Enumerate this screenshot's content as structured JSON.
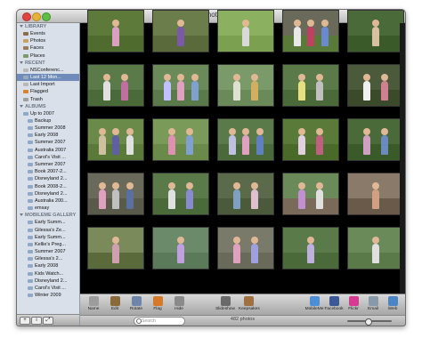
{
  "window": {
    "title": "iPhoto"
  },
  "sidebar": {
    "sections": [
      {
        "header": "LIBRARY",
        "items": [
          {
            "label": "Events",
            "color": "#8a6d4a",
            "sub": false
          },
          {
            "label": "Photos",
            "color": "#c9a063",
            "sub": false
          },
          {
            "label": "Faces",
            "color": "#9a7b5c",
            "sub": false
          },
          {
            "label": "Places",
            "color": "#7a9a6a",
            "sub": false
          }
        ]
      },
      {
        "header": "RECENT",
        "items": [
          {
            "label": "NSConferenc...",
            "color": "#b8b8b8",
            "sub": false
          },
          {
            "label": "Last 12 Mon...",
            "color": "#9aa8c0",
            "sub": false,
            "selected": true
          },
          {
            "label": "Last Import",
            "color": "#b8b8b8",
            "sub": false
          },
          {
            "label": "Flagged",
            "color": "#d9822b",
            "sub": false
          },
          {
            "label": "Trash",
            "color": "#a0a0a0",
            "sub": false
          }
        ]
      },
      {
        "header": "ALBUMS",
        "items": [
          {
            "label": "Up to 2007",
            "color": "#8fa9c8",
            "sub": false
          },
          {
            "label": "Backup",
            "color": "#8fa9c8",
            "sub": true
          },
          {
            "label": "Summer 2008",
            "color": "#8fa9c8",
            "sub": true
          },
          {
            "label": "Early 2008",
            "color": "#8fa9c8",
            "sub": true
          },
          {
            "label": "Summer 2007",
            "color": "#8fa9c8",
            "sub": true
          },
          {
            "label": "Australia 2007",
            "color": "#8fa9c8",
            "sub": true
          },
          {
            "label": "Carol's Visit ...",
            "color": "#8fa9c8",
            "sub": true
          },
          {
            "label": "Summer 2007",
            "color": "#8fa9c8",
            "sub": true
          },
          {
            "label": "Book 2007-2...",
            "color": "#8fa9c8",
            "sub": true
          },
          {
            "label": "Disneyland 2...",
            "color": "#8fa9c8",
            "sub": true
          },
          {
            "label": "Book 2008-2...",
            "color": "#8fa9c8",
            "sub": true
          },
          {
            "label": "Disneyland 2...",
            "color": "#8fa9c8",
            "sub": true
          },
          {
            "label": "Australia 200...",
            "color": "#8fa9c8",
            "sub": true
          },
          {
            "label": "emsay",
            "color": "#8fa9c8",
            "sub": true
          }
        ]
      },
      {
        "header": "MOBILEME GALLERY",
        "items": [
          {
            "label": "Early Summ...",
            "color": "#8fa9c8",
            "sub": true
          },
          {
            "label": "Gilessa's Ze...",
            "color": "#8fa9c8",
            "sub": true
          },
          {
            "label": "Early Summ...",
            "color": "#8fa9c8",
            "sub": true
          },
          {
            "label": "Kellie's Preg...",
            "color": "#8fa9c8",
            "sub": true
          },
          {
            "label": "Summer 2007",
            "color": "#8fa9c8",
            "sub": true
          },
          {
            "label": "Gilessa's 2...",
            "color": "#8fa9c8",
            "sub": true
          },
          {
            "label": "Early 2008",
            "color": "#8fa9c8",
            "sub": true
          },
          {
            "label": "Kids Watch...",
            "color": "#8fa9c8",
            "sub": true
          },
          {
            "label": "Disneyland 2...",
            "color": "#8fa9c8",
            "sub": true
          },
          {
            "label": "Carol's Visit ...",
            "color": "#8fa9c8",
            "sub": true
          },
          {
            "label": "Winter 2009",
            "color": "#8fa9c8",
            "sub": true
          }
        ]
      }
    ],
    "bottom_buttons": [
      "+",
      "i",
      "⤢"
    ]
  },
  "toolbar": {
    "left": [
      {
        "label": "Name",
        "color": "#9c9c9c"
      },
      {
        "label": "Edit",
        "color": "#8a6a3a"
      },
      {
        "label": "Rotate",
        "color": "#6f86a8"
      },
      {
        "label": "Flag",
        "color": "#d67a2a"
      },
      {
        "label": "Hide",
        "color": "#8a8a8a"
      }
    ],
    "middle": [
      {
        "label": "Slideshow",
        "color": "#6a6a6a"
      },
      {
        "label": "Keepsakes",
        "color": "#a07040"
      }
    ],
    "right": [
      {
        "label": "MobileMe",
        "color": "#4d8fd6"
      },
      {
        "label": "Facebook",
        "color": "#3b5998"
      },
      {
        "label": "Flickr",
        "color": "#d63b8f"
      },
      {
        "label": "Email",
        "color": "#8899aa"
      },
      {
        "label": "iWeb",
        "color": "#4a86c6"
      }
    ]
  },
  "status": {
    "search_placeholder": "Search",
    "photo_count": "482 photos",
    "zoom_level": 0.45
  },
  "grid": {
    "columns": 5,
    "rows": 6,
    "photos": [
      {
        "sky": "#5d7a3a",
        "grass": "#4f6b2e",
        "figs": [
          "#d9a0c0"
        ]
      },
      {
        "sky": "#6a7d4a",
        "grass": "#5a6a3a",
        "figs": [
          "#7a5aa8"
        ]
      },
      {
        "sky": "#8ab060",
        "grass": "#7aa050",
        "figs": [
          "#d9d9d9"
        ]
      },
      {
        "sky": "#6a6a5a",
        "grass": "#5a7a3a",
        "figs": [
          "#e8e8e8",
          "#c04060",
          "#6a8ad0"
        ]
      },
      {
        "sky": "#4a6a3a",
        "grass": "#3a5a2a",
        "figs": [
          "#d9c0a0"
        ]
      },
      {
        "sky": "#5a7a4a",
        "grass": "#4a6a3a",
        "figs": [
          "#e0e0e0",
          "#c070a0"
        ]
      },
      {
        "sky": "#6a8a5a",
        "grass": "#5a7a4a",
        "figs": [
          "#c0c0ff",
          "#e0a0c0",
          "#80a0d0"
        ]
      },
      {
        "sky": "#7a9a6a",
        "grass": "#6a8a5a",
        "figs": [
          "#e0e0d0",
          "#d0b060"
        ]
      },
      {
        "sky": "#5a7a4a",
        "grass": "#4a6a3a",
        "figs": [
          "#e8e080",
          "#c0c0c0"
        ]
      },
      {
        "sky": "#4a5a3a",
        "grass": "#3a4a2a",
        "figs": [
          "#f0f0f0",
          "#d08090"
        ]
      },
      {
        "sky": "#6a8a4a",
        "grass": "#5a7a3a",
        "figs": [
          "#d0c0a0",
          "#6060a0",
          "#e0e0e0"
        ]
      },
      {
        "sky": "#7a9a5a",
        "grass": "#6a8a4a",
        "figs": [
          "#e090b0",
          "#80a0d0"
        ]
      },
      {
        "sky": "#5a7a4a",
        "grass": "#4a6a3a",
        "figs": [
          "#c0c0e0",
          "#e0a0c0",
          "#6080c0"
        ]
      },
      {
        "sky": "#5a7a3a",
        "grass": "#4a6a2a",
        "figs": [
          "#e0d0e0",
          "#c06080"
        ]
      },
      {
        "sky": "#4a6a3a",
        "grass": "#3a5a2a",
        "figs": [
          "#d0a0c0",
          "#6a8ac0"
        ]
      },
      {
        "sky": "#6a6a5a",
        "grass": "#5a5a4a",
        "figs": [
          "#e0a0c0",
          "#c0c0c0",
          "#5a70a0"
        ]
      },
      {
        "sky": "#5a7a4a",
        "grass": "#4a6a3a",
        "figs": [
          "#e0e0e0",
          "#8a8ad0"
        ]
      },
      {
        "sky": "#5a6a4a",
        "grass": "#4a5a3a",
        "figs": [
          "#80a0c0",
          "#e0c0d0"
        ]
      },
      {
        "sky": "#6a8a5a",
        "grass": "#7a6a5a",
        "figs": [
          "#c090d0",
          "#e0e0e0"
        ]
      },
      {
        "sky": "#8a7a6a",
        "grass": "#6a5a4a",
        "figs": [
          "#d0a080"
        ]
      },
      {
        "sky": "#7a8a5a",
        "grass": "#5a6a3a",
        "figs": [
          "#d0a0b0"
        ]
      },
      {
        "sky": "#6a8a6a",
        "grass": "#5a7a5a",
        "figs": [
          "#c0a0e0"
        ]
      },
      {
        "sky": "#7a7a6a",
        "grass": "#6a6a5a",
        "figs": [
          "#e0a0c0",
          "#a0a0e0"
        ]
      },
      {
        "sky": "#5a7a4a",
        "grass": "#4a6a3a",
        "figs": [
          "#c0b0e0"
        ]
      },
      {
        "sky": "#6a8a5a",
        "grass": "#5a7a4a",
        "figs": [
          "#e0e0e0"
        ]
      }
    ]
  }
}
